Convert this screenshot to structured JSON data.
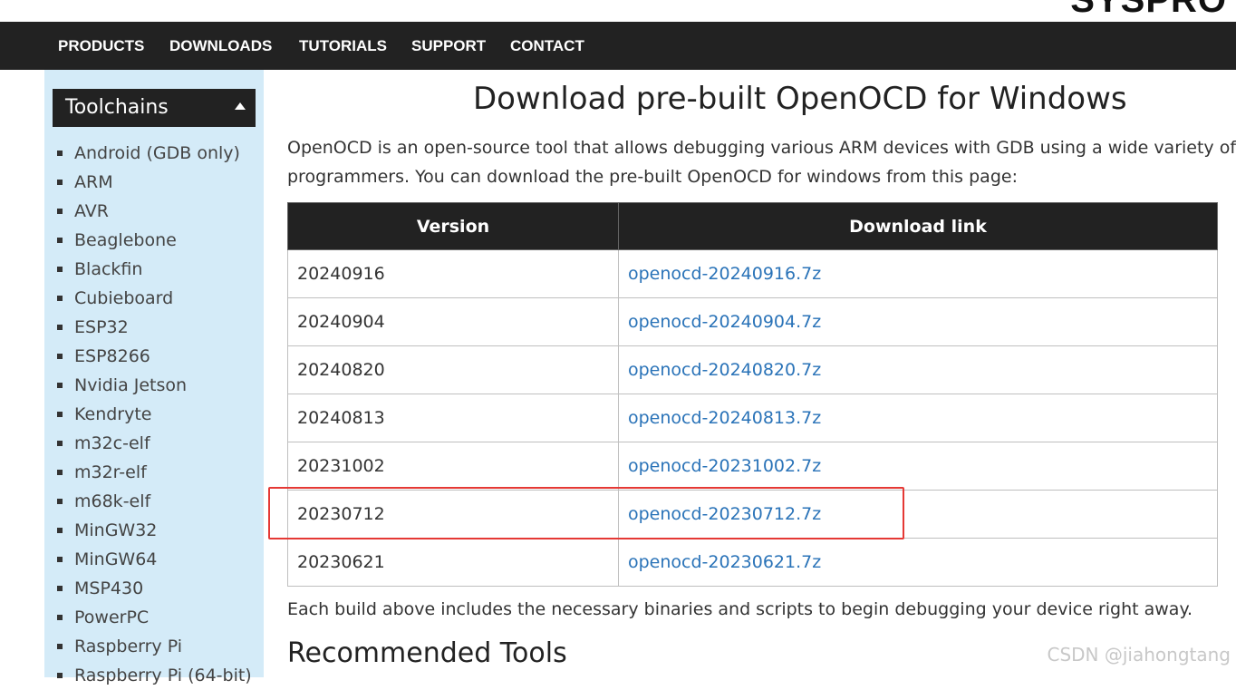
{
  "brand": {
    "logo_text": "SYSPRO"
  },
  "nav": {
    "items": [
      {
        "label": "PRODUCTS"
      },
      {
        "label": "DOWNLOADS"
      },
      {
        "label": "TUTORIALS"
      },
      {
        "label": "SUPPORT"
      },
      {
        "label": "CONTACT"
      }
    ]
  },
  "sidebar": {
    "title": "Toolchains",
    "items": [
      {
        "label": "Android (GDB only)"
      },
      {
        "label": "ARM"
      },
      {
        "label": "AVR"
      },
      {
        "label": "Beaglebone"
      },
      {
        "label": "Blackfin"
      },
      {
        "label": "Cubieboard"
      },
      {
        "label": "ESP32"
      },
      {
        "label": "ESP8266"
      },
      {
        "label": "Nvidia Jetson"
      },
      {
        "label": "Kendryte"
      },
      {
        "label": "m32c-elf"
      },
      {
        "label": "m32r-elf"
      },
      {
        "label": "m68k-elf"
      },
      {
        "label": "MinGW32"
      },
      {
        "label": "MinGW64"
      },
      {
        "label": "MSP430"
      },
      {
        "label": "PowerPC"
      },
      {
        "label": "Raspberry Pi"
      },
      {
        "label": "Raspberry Pi (64-bit)"
      }
    ]
  },
  "main": {
    "title": "Download pre-built OpenOCD for Windows",
    "intro_line1": "OpenOCD is an open-source tool that allows debugging various ARM devices with GDB using a wide variety of JTAG",
    "intro_line2": "programmers. You can download the pre-built OpenOCD for windows from this page:",
    "table": {
      "headers": {
        "version": "Version",
        "link": "Download link"
      },
      "rows": [
        {
          "version": "20240916",
          "link": "openocd-20240916.7z"
        },
        {
          "version": "20240904",
          "link": "openocd-20240904.7z"
        },
        {
          "version": "20240820",
          "link": "openocd-20240820.7z"
        },
        {
          "version": "20240813",
          "link": "openocd-20240813.7z"
        },
        {
          "version": "20231002",
          "link": "openocd-20231002.7z"
        },
        {
          "version": "20230712",
          "link": "openocd-20230712.7z"
        },
        {
          "version": "20230621",
          "link": "openocd-20230621.7z"
        }
      ]
    },
    "footnote": "Each build above includes the necessary binaries and scripts to begin debugging your device right away.",
    "section_title": "Recommended Tools"
  },
  "watermark": "CSDN @jiahongtang",
  "colors": {
    "nav_bg": "#222222",
    "sidebar_bg": "#d4ebf8",
    "link": "#2a73b8",
    "highlight": "#e53935"
  }
}
